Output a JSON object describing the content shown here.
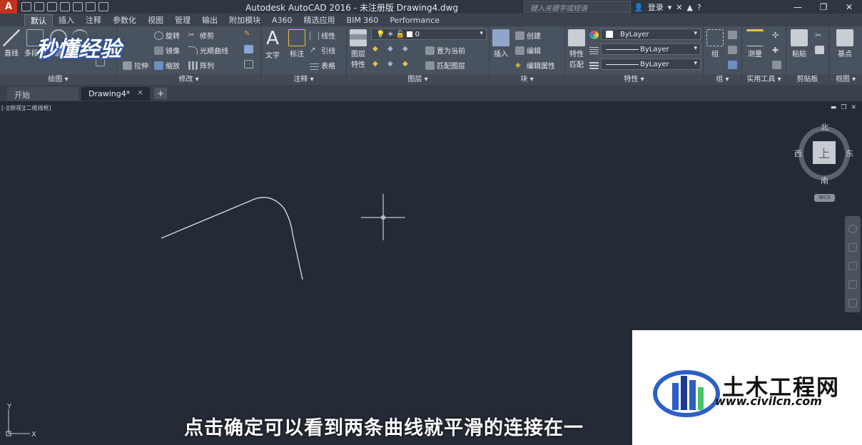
{
  "app": {
    "logo_letter": "A",
    "title": "Autodesk AutoCAD 2016 - 未注册版    Drawing4.dwg",
    "search_placeholder": "键入关键字或短语",
    "login_label": "登录",
    "colors": {
      "titlebar": "#2f3640",
      "ribbon": "#49525f",
      "canvas": "#252b36",
      "logo": "#c5301f",
      "accent_blue": "#2d5fc7"
    }
  },
  "ribbon_tabs": [
    "默认",
    "插入",
    "注释",
    "参数化",
    "视图",
    "管理",
    "输出",
    "附加模块",
    "A360",
    "精选应用",
    "BIM 360",
    "Performance"
  ],
  "ribbon": {
    "draw": {
      "title": "绘图 ▾",
      "line": "直线",
      "polyline": "多段线",
      "circle": "圆",
      "arc": "圆弧"
    },
    "modify": {
      "title": "修改 ▾",
      "rotate": "旋转",
      "trim": "修剪",
      "mirror": "镜像",
      "fillet": "光顺曲线",
      "stretch": "拉伸",
      "scale": "缩放",
      "array": "阵列"
    },
    "annotation": {
      "title": "注释 ▾",
      "text": "文字",
      "dimension": "标注",
      "linear": "线性",
      "leader": "引线",
      "table": "表格"
    },
    "layers": {
      "title": "图层 ▾",
      "layer_props": "图层\n特性",
      "current_layer": "0",
      "set_current": "置为当前",
      "match_layer": "匹配图层"
    },
    "block": {
      "title": "块 ▾",
      "insert": "插入",
      "create": "创建",
      "edit": "编辑",
      "edit_attr": "编辑属性"
    },
    "properties": {
      "title": "特性 ▾",
      "match": "特性\n匹配",
      "color": "ByLayer",
      "linetype": "ByLayer",
      "lineweight": "ByLayer"
    },
    "groups": {
      "title": "组 ▾",
      "group": "组"
    },
    "utilities": {
      "title": "实用工具 ▾",
      "measure": "测量"
    },
    "clipboard": {
      "title": "剪贴板",
      "paste": "粘贴"
    },
    "view": {
      "title": "视图 ▾",
      "base": "基点"
    }
  },
  "doc_tabs": {
    "start": "开始",
    "drawing": "Drawing4*",
    "close": "×",
    "add": "+"
  },
  "viewport": {
    "label": "[-][俯视][二维线框]",
    "viewcube": {
      "north": "北",
      "south": "南",
      "east": "东",
      "west": "西",
      "face": "上",
      "wcs": "WCS"
    },
    "ucs": {
      "x": "X",
      "y": "Y"
    }
  },
  "subtitle": "点击确定可以看到两条曲线就平滑的连接在一",
  "watermark": {
    "top_logo": "秒懂经验",
    "site_name": "土木工程网",
    "site_url": "www.civilcn.com"
  }
}
